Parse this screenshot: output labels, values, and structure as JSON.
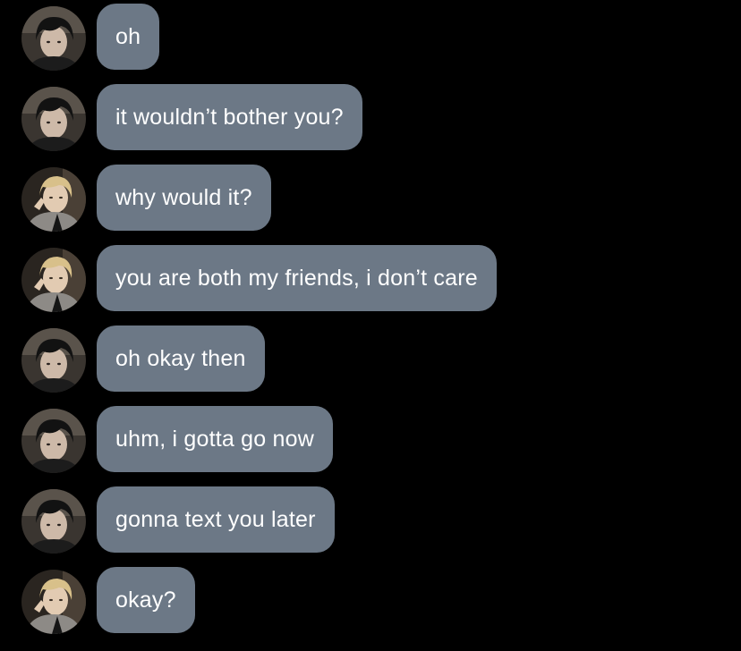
{
  "colors": {
    "background": "#000000",
    "bubble": "#6c7886",
    "text": "#ffffff"
  },
  "messages": [
    {
      "avatar": "dark-haired-contact-avatar",
      "text": "oh"
    },
    {
      "avatar": "dark-haired-contact-avatar",
      "text": "it wouldn’t bother you?"
    },
    {
      "avatar": "blond-contact-avatar",
      "text": "why would it?"
    },
    {
      "avatar": "blond-contact-avatar",
      "text": "you are both my friends, i don’t care"
    },
    {
      "avatar": "dark-haired-contact-avatar",
      "text": "oh okay then"
    },
    {
      "avatar": "dark-haired-contact-avatar",
      "text": "uhm, i gotta go now"
    },
    {
      "avatar": "dark-haired-contact-avatar",
      "text": "gonna text you later"
    },
    {
      "avatar": "blond-contact-avatar",
      "text": "okay?"
    }
  ]
}
